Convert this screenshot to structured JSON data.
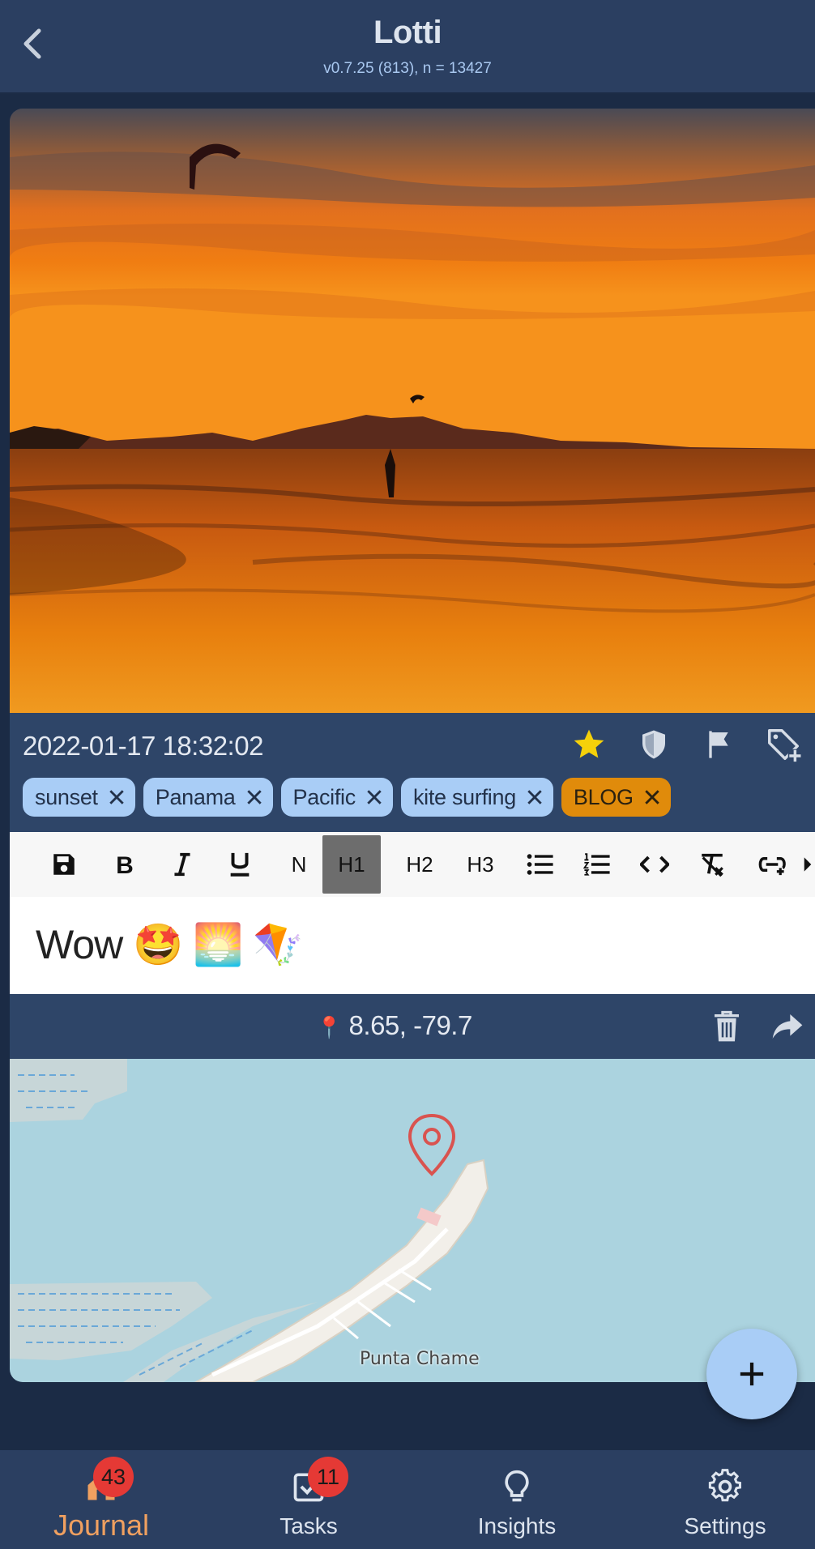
{
  "app": {
    "title": "Lotti",
    "version": "v0.7.25 (813), n = 13427"
  },
  "entry": {
    "date": "2022-01-17 18:32:02",
    "starred": true,
    "tags": [
      {
        "label": "sunset",
        "color": "#a9cdf6"
      },
      {
        "label": "Panama",
        "color": "#a9cdf6"
      },
      {
        "label": "Pacific",
        "color": "#a9cdf6"
      },
      {
        "label": "kite surfing",
        "color": "#a9cdf6"
      },
      {
        "label": "BLOG",
        "color": "#e08b0b"
      }
    ],
    "toolbar": {
      "normal": "N",
      "h1": "H1",
      "h2": "H2",
      "h3": "H3",
      "selected": "H1"
    },
    "text": "Wow 🤩 🌅 🪁",
    "location": "8.65, -79.7",
    "location_pin": "📍",
    "map_place": "Punta Chame"
  },
  "nav": {
    "journal": {
      "label": "Journal",
      "badge": "43"
    },
    "tasks": {
      "label": "Tasks",
      "badge": "11"
    },
    "insights": {
      "label": "Insights"
    },
    "settings": {
      "label": "Settings"
    }
  },
  "colors": {
    "appbar": "#2b3f61",
    "card": "#2e4568",
    "tag": "#a9cdf6",
    "tag_blog": "#e08b0b",
    "star": "#f5d10a",
    "badge": "#e53935",
    "active_nav": "#f0a060"
  }
}
